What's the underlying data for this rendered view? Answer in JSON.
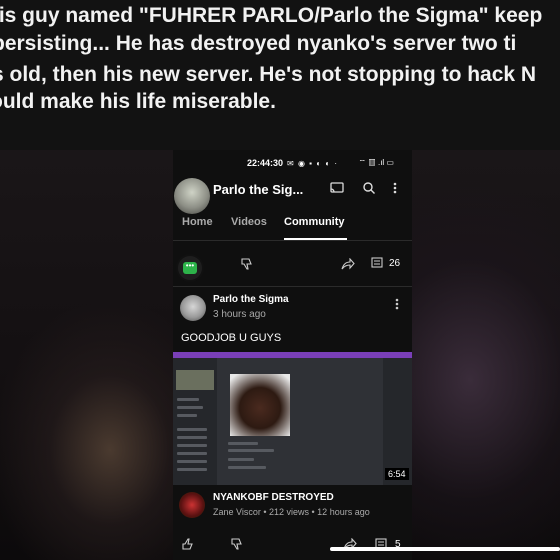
{
  "caption": {
    "line1": "his guy named \"FUHRER PARLO/Parlo the Sigma\" keep",
    "line2": "persisting... He has destroyed nyanko's server two ti",
    "line3": "s old, then his new server. He's not stopping to hack N",
    "line4": "ould make his life miserable."
  },
  "statusbar": {
    "time": "22:44:30",
    "icons": "✉ ◉ ▪ ◐ ◐ ·",
    "right": "⌔ ▥ .ıl ▭"
  },
  "channel": {
    "title": "Parlo the Sig...",
    "cast_icon": "cast-icon",
    "search_icon": "search-icon",
    "menu_icon": "more-vert-icon"
  },
  "tabs": {
    "home": "Home",
    "videos": "Videos",
    "community": "Community"
  },
  "poll_row": {
    "comment_count": "26"
  },
  "post": {
    "author": "Parlo the Sigma",
    "time": "3 hours ago",
    "text": "GOODJOB U GUYS"
  },
  "video": {
    "duration": "6:54",
    "title": "NYANKOBF DESTROYED",
    "meta": "Zane Viscor • 212 views • 12 hours ago"
  },
  "bottom_row": {
    "comment_count": "5"
  }
}
